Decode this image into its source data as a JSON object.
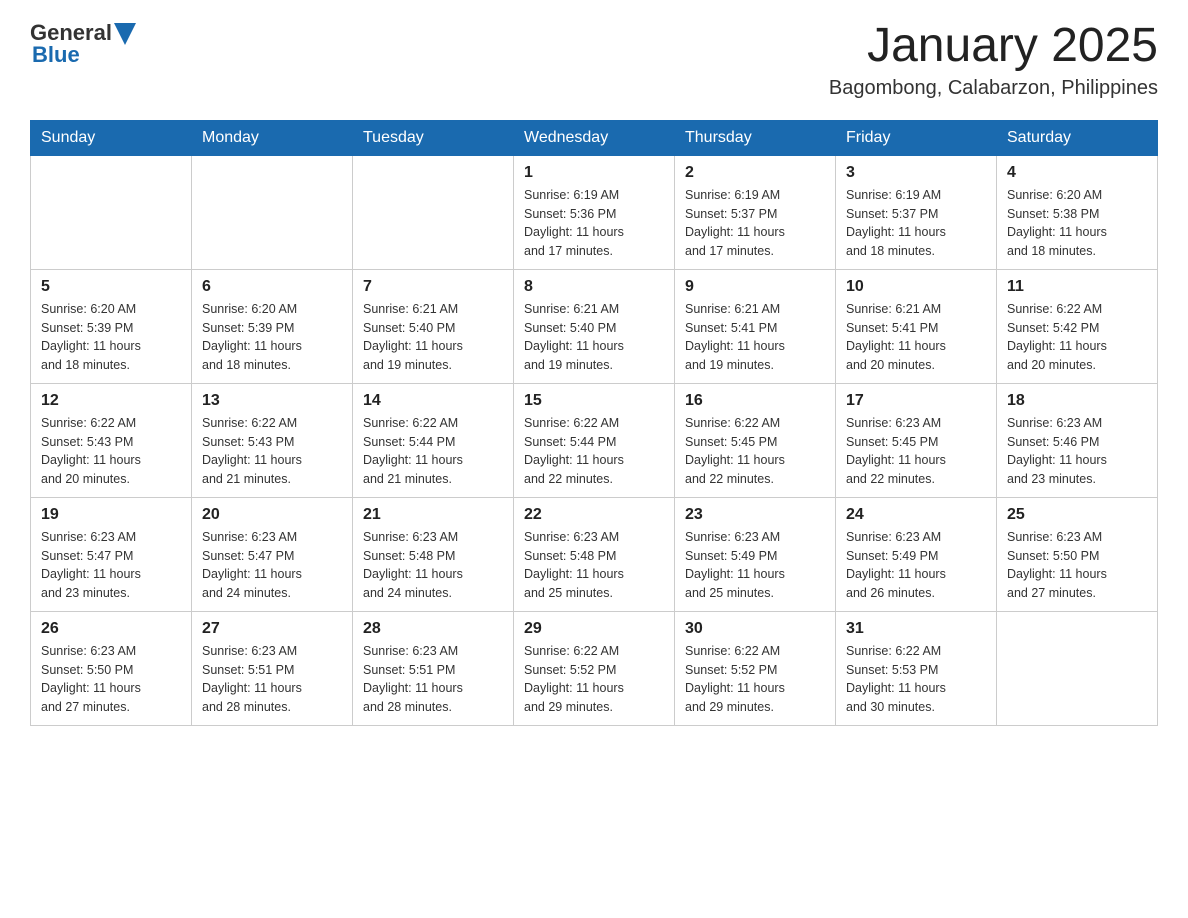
{
  "header": {
    "logo": {
      "general": "General",
      "blue": "Blue"
    },
    "title": "January 2025",
    "location": "Bagombong, Calabarzon, Philippines"
  },
  "weekdays": [
    "Sunday",
    "Monday",
    "Tuesday",
    "Wednesday",
    "Thursday",
    "Friday",
    "Saturday"
  ],
  "weeks": [
    [
      {
        "day": "",
        "info": ""
      },
      {
        "day": "",
        "info": ""
      },
      {
        "day": "",
        "info": ""
      },
      {
        "day": "1",
        "info": "Sunrise: 6:19 AM\nSunset: 5:36 PM\nDaylight: 11 hours\nand 17 minutes."
      },
      {
        "day": "2",
        "info": "Sunrise: 6:19 AM\nSunset: 5:37 PM\nDaylight: 11 hours\nand 17 minutes."
      },
      {
        "day": "3",
        "info": "Sunrise: 6:19 AM\nSunset: 5:37 PM\nDaylight: 11 hours\nand 18 minutes."
      },
      {
        "day": "4",
        "info": "Sunrise: 6:20 AM\nSunset: 5:38 PM\nDaylight: 11 hours\nand 18 minutes."
      }
    ],
    [
      {
        "day": "5",
        "info": "Sunrise: 6:20 AM\nSunset: 5:39 PM\nDaylight: 11 hours\nand 18 minutes."
      },
      {
        "day": "6",
        "info": "Sunrise: 6:20 AM\nSunset: 5:39 PM\nDaylight: 11 hours\nand 18 minutes."
      },
      {
        "day": "7",
        "info": "Sunrise: 6:21 AM\nSunset: 5:40 PM\nDaylight: 11 hours\nand 19 minutes."
      },
      {
        "day": "8",
        "info": "Sunrise: 6:21 AM\nSunset: 5:40 PM\nDaylight: 11 hours\nand 19 minutes."
      },
      {
        "day": "9",
        "info": "Sunrise: 6:21 AM\nSunset: 5:41 PM\nDaylight: 11 hours\nand 19 minutes."
      },
      {
        "day": "10",
        "info": "Sunrise: 6:21 AM\nSunset: 5:41 PM\nDaylight: 11 hours\nand 20 minutes."
      },
      {
        "day": "11",
        "info": "Sunrise: 6:22 AM\nSunset: 5:42 PM\nDaylight: 11 hours\nand 20 minutes."
      }
    ],
    [
      {
        "day": "12",
        "info": "Sunrise: 6:22 AM\nSunset: 5:43 PM\nDaylight: 11 hours\nand 20 minutes."
      },
      {
        "day": "13",
        "info": "Sunrise: 6:22 AM\nSunset: 5:43 PM\nDaylight: 11 hours\nand 21 minutes."
      },
      {
        "day": "14",
        "info": "Sunrise: 6:22 AM\nSunset: 5:44 PM\nDaylight: 11 hours\nand 21 minutes."
      },
      {
        "day": "15",
        "info": "Sunrise: 6:22 AM\nSunset: 5:44 PM\nDaylight: 11 hours\nand 22 minutes."
      },
      {
        "day": "16",
        "info": "Sunrise: 6:22 AM\nSunset: 5:45 PM\nDaylight: 11 hours\nand 22 minutes."
      },
      {
        "day": "17",
        "info": "Sunrise: 6:23 AM\nSunset: 5:45 PM\nDaylight: 11 hours\nand 22 minutes."
      },
      {
        "day": "18",
        "info": "Sunrise: 6:23 AM\nSunset: 5:46 PM\nDaylight: 11 hours\nand 23 minutes."
      }
    ],
    [
      {
        "day": "19",
        "info": "Sunrise: 6:23 AM\nSunset: 5:47 PM\nDaylight: 11 hours\nand 23 minutes."
      },
      {
        "day": "20",
        "info": "Sunrise: 6:23 AM\nSunset: 5:47 PM\nDaylight: 11 hours\nand 24 minutes."
      },
      {
        "day": "21",
        "info": "Sunrise: 6:23 AM\nSunset: 5:48 PM\nDaylight: 11 hours\nand 24 minutes."
      },
      {
        "day": "22",
        "info": "Sunrise: 6:23 AM\nSunset: 5:48 PM\nDaylight: 11 hours\nand 25 minutes."
      },
      {
        "day": "23",
        "info": "Sunrise: 6:23 AM\nSunset: 5:49 PM\nDaylight: 11 hours\nand 25 minutes."
      },
      {
        "day": "24",
        "info": "Sunrise: 6:23 AM\nSunset: 5:49 PM\nDaylight: 11 hours\nand 26 minutes."
      },
      {
        "day": "25",
        "info": "Sunrise: 6:23 AM\nSunset: 5:50 PM\nDaylight: 11 hours\nand 27 minutes."
      }
    ],
    [
      {
        "day": "26",
        "info": "Sunrise: 6:23 AM\nSunset: 5:50 PM\nDaylight: 11 hours\nand 27 minutes."
      },
      {
        "day": "27",
        "info": "Sunrise: 6:23 AM\nSunset: 5:51 PM\nDaylight: 11 hours\nand 28 minutes."
      },
      {
        "day": "28",
        "info": "Sunrise: 6:23 AM\nSunset: 5:51 PM\nDaylight: 11 hours\nand 28 minutes."
      },
      {
        "day": "29",
        "info": "Sunrise: 6:22 AM\nSunset: 5:52 PM\nDaylight: 11 hours\nand 29 minutes."
      },
      {
        "day": "30",
        "info": "Sunrise: 6:22 AM\nSunset: 5:52 PM\nDaylight: 11 hours\nand 29 minutes."
      },
      {
        "day": "31",
        "info": "Sunrise: 6:22 AM\nSunset: 5:53 PM\nDaylight: 11 hours\nand 30 minutes."
      },
      {
        "day": "",
        "info": ""
      }
    ]
  ]
}
